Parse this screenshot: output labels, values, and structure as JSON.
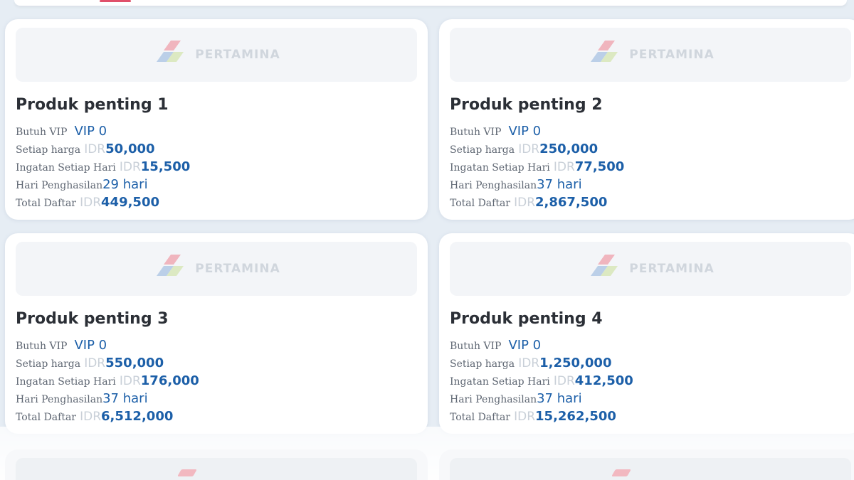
{
  "brand": {
    "logo_text": "PERTAMINA"
  },
  "colors": {
    "accent_value": "#1c5fa8",
    "card_bg": "#ffffff",
    "page_bg": "#e6edf4"
  },
  "labels": {
    "vip": "Butuh VIP",
    "price": "Setiap harga",
    "daily": "Ingatan Setiap Hari",
    "days": "Hari Penghasilan",
    "total": "Total Daftar",
    "currency": "IDR"
  },
  "products": [
    {
      "title": "Produk penting 1",
      "vip": "VIP 0",
      "price": "50,000",
      "daily": "15,500",
      "days": "29 hari",
      "total": "449,500"
    },
    {
      "title": "Produk penting 2",
      "vip": "VIP 0",
      "price": "250,000",
      "daily": "77,500",
      "days": "37 hari",
      "total": "2,867,500"
    },
    {
      "title": "Produk penting 3",
      "vip": "VIP 0",
      "price": "550,000",
      "daily": "176,000",
      "days": "37 hari",
      "total": "6,512,000"
    },
    {
      "title": "Produk penting 4",
      "vip": "VIP 0",
      "price": "1,250,000",
      "daily": "412,500",
      "days": "37 hari",
      "total": "15,262,500"
    }
  ]
}
